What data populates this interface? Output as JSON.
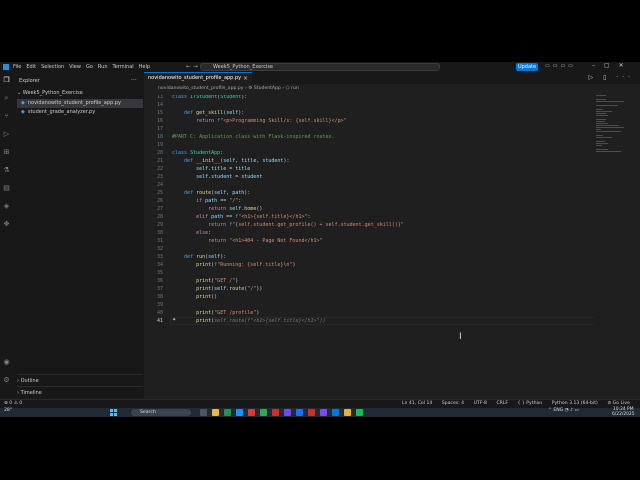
{
  "window": {
    "menu": [
      "File",
      "Edit",
      "Selection",
      "View",
      "Go",
      "Run",
      "Terminal",
      "Help"
    ],
    "search_title": "Week5_Python_Exercise",
    "update_label": "Update"
  },
  "sidebar": {
    "title": "Explorer",
    "folder": "Week5_Python_Exercise",
    "files": [
      {
        "name": "novidanowito_student_profile_app.py",
        "active": true
      },
      {
        "name": "student_grade_analyzer.py",
        "active": false
      }
    ],
    "outline_label": "Outline",
    "timeline_label": "Timeline"
  },
  "editor": {
    "tab_label": "novidanowito_student_profile_app.py",
    "breadcrumb": "novidanowito_student_profile_app.py › ⚙ StudentApp › ⬡ run",
    "lines": [
      {
        "n": "13",
        "html": "<span class='kw'>class</span> <span class='cls'>ITStudent</span>(<span class='cls'>Student</span>):"
      },
      {
        "n": "14",
        "html": ""
      },
      {
        "n": "15",
        "html": "    <span class='kw'>def</span> <span class='fn'>get_skill</span>(<span class='var'>self</span>):"
      },
      {
        "n": "16",
        "html": "        <span class='kw2'>return</span> <span class='kw'>f</span><span class='str'>\"&lt;p&gt;Programming Skill/s: {self.skill}&lt;/p&gt;\"</span>"
      },
      {
        "n": "17",
        "html": ""
      },
      {
        "n": "18",
        "html": "<span class='cmt'>#PART C: Application class with Flask-inspired routes.</span>"
      },
      {
        "n": "19",
        "html": ""
      },
      {
        "n": "20",
        "html": "<span class='kw'>class</span> <span class='cls'>StudentApp</span>:"
      },
      {
        "n": "21",
        "html": "    <span class='kw'>def</span> <span class='fn'>__init__</span>(<span class='var'>self</span>, <span class='var'>title</span>, <span class='var'>student</span>):"
      },
      {
        "n": "22",
        "html": "        <span class='var'>self</span>.<span class='var'>title</span> = <span class='var'>title</span>"
      },
      {
        "n": "23",
        "html": "        <span class='var'>self</span>.<span class='var'>student</span> = <span class='var'>student</span>"
      },
      {
        "n": "24",
        "html": ""
      },
      {
        "n": "25",
        "html": "    <span class='kw'>def</span> <span class='fn'>route</span>(<span class='var'>self</span>, <span class='var'>path</span>):"
      },
      {
        "n": "26",
        "html": "        <span class='kw2'>if</span> <span class='var'>path</span> == <span class='str'>\"/\"</span>:"
      },
      {
        "n": "27",
        "html": "            <span class='kw2'>return</span> <span class='var'>self</span>.<span class='fn'>home</span>()"
      },
      {
        "n": "28",
        "html": "        <span class='kw2'>elif</span> <span class='var'>path</span> == <span class='kw'>f</span><span class='str'>\"&lt;h1&gt;{self.title}&lt;/h1&gt;\"</span>:"
      },
      {
        "n": "29",
        "html": "            <span class='kw2'>return</span> <span class='kw'>f</span><span class='str'>\"{self.student.get_profile() + self.student.get_skill()}\"</span>"
      },
      {
        "n": "30",
        "html": "        <span class='kw2'>else</span>:"
      },
      {
        "n": "31",
        "html": "            <span class='kw2'>return</span> <span class='str'>\"&lt;h1&gt;404 - Page Not Found&lt;/h1&gt;\"</span>"
      },
      {
        "n": "32",
        "html": ""
      },
      {
        "n": "33",
        "html": "    <span class='kw'>def</span> <span class='fn'>run</span>(<span class='var'>self</span>):"
      },
      {
        "n": "34",
        "html": "        <span class='fn'>print</span>(<span class='kw'>f</span><span class='str'>\"Running: {self.title}\\n\"</span>)"
      },
      {
        "n": "35",
        "html": ""
      },
      {
        "n": "36",
        "html": "        <span class='fn'>print</span>(<span class='str'>\"GET /\"</span>)"
      },
      {
        "n": "37",
        "html": "        <span class='fn'>print</span>(<span class='var'>self</span>.<span class='fn'>route</span>(<span class='str'>\"/\"</span>))"
      },
      {
        "n": "38",
        "html": "        <span class='fn'>print</span>()"
      },
      {
        "n": "39",
        "html": ""
      },
      {
        "n": "40",
        "html": "        <span class='fn'>print</span>(<span class='str'>\"GET /profile\"</span>)"
      },
      {
        "n": "41",
        "html": "        <span class='fn'>print</span>(<span class='ghost'>self.route(f\"&lt;h1&gt;{self.title}&lt;/h1&gt;\"))</span>"
      }
    ],
    "current_line": "41"
  },
  "statusbar": {
    "left": "⊗ 0 ⚠ 0",
    "position": "Ln 41, Col 14",
    "spaces": "Spaces: 4",
    "encoding": "UTF-8",
    "eol": "CRLF",
    "language": "{ } Python",
    "interpreter": "Python 3.13 (64-bit)",
    "golive": "⊘ Go Live"
  },
  "taskbar": {
    "weather": "28°",
    "search_placeholder": "Search",
    "lang": "ENG",
    "time": "10:24 PM",
    "date": "6/22/2025"
  },
  "colors": {
    "accent": "#0078d4",
    "editor_bg": "#1f1f1f",
    "sidebar_bg": "#181818"
  }
}
